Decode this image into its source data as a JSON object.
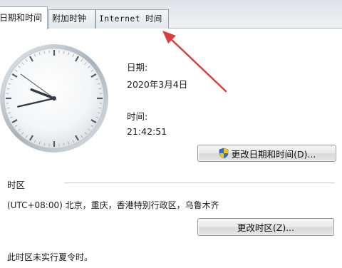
{
  "tabs": [
    {
      "label": "日期和时间"
    },
    {
      "label": "附加时钟"
    },
    {
      "label": "Internet 时间"
    }
  ],
  "clock": {
    "hour": 21,
    "minute": 42,
    "second": 51
  },
  "date": {
    "label": "日期:",
    "value": "2020年3月4日"
  },
  "time": {
    "label": "时间:",
    "value": "21:42:51"
  },
  "change_datetime_button": "更改日期和时间(D)...",
  "timezone": {
    "header": "时区",
    "value": "(UTC+08:00) 北京，重庆，香港特别行政区，乌鲁木齐",
    "change_button": "更改时区(Z)..."
  },
  "dst_note": "此时区未实行夏令时。",
  "icons": {
    "uac": "shield-icon",
    "annotation": "red-arrow-icon"
  },
  "colors": {
    "arrow": "#d7403a",
    "tab_border": "#9ea7b2"
  }
}
